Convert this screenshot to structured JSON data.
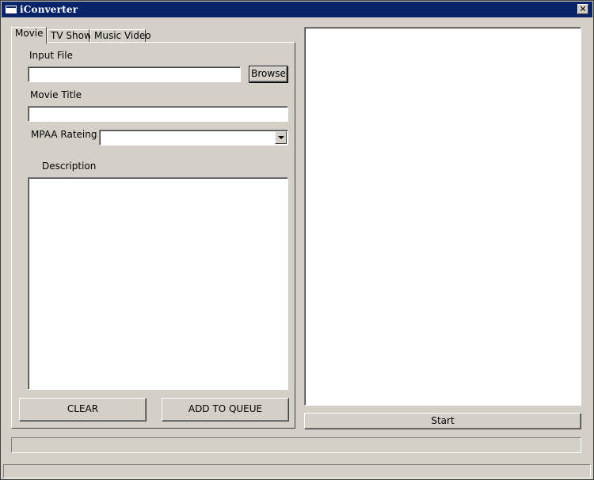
{
  "window": {
    "title": "iConverter"
  },
  "tabs": [
    {
      "label": "Movie",
      "selected": true
    },
    {
      "label": "TV Show",
      "selected": false
    },
    {
      "label": "Music Video",
      "selected": false
    }
  ],
  "movie_form": {
    "input_file_label": "Input File",
    "input_file_value": "",
    "browse_label": "Browse",
    "movie_title_label": "Movie Title",
    "movie_title_value": "",
    "mpaa_label": "MPAA Rateing",
    "mpaa_value": "",
    "description_label": "Description",
    "description_value": "",
    "clear_label": "CLEAR",
    "add_to_queue_label": "ADD TO QUEUE"
  },
  "queue": {
    "start_label": "Start"
  },
  "status": {
    "progress": 0,
    "text": ""
  }
}
